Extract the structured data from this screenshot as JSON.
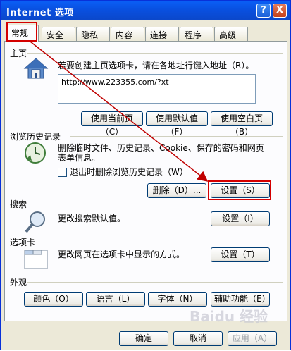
{
  "window": {
    "title": "Internet 选项"
  },
  "titlebar_buttons": {
    "help": "?",
    "close": "X"
  },
  "tabs": [
    "常规",
    "安全",
    "隐私",
    "内容",
    "连接",
    "程序",
    "高级"
  ],
  "home": {
    "heading": "主页",
    "desc": "若要创建主页选项卡，请在各地址行键入地址（R）。",
    "url": "http://www.223355.com/?xt",
    "buttons": [
      "使用当前页（C）",
      "使用默认值（F）",
      "使用空白页（B）"
    ]
  },
  "history": {
    "heading": "浏览历史记录",
    "desc_line1": "删除临时文件、历史记录、Cookie、保存的密码和网页",
    "desc_line2": "表单信息。",
    "checkbox_label": "退出时删除浏览历史记录（W）",
    "delete_button": "删除（D）...",
    "settings_button": "设置（S）"
  },
  "search": {
    "heading": "搜索",
    "desc": "更改搜索默认值。",
    "settings_button": "设置（I）"
  },
  "tabs_section": {
    "heading": "选项卡",
    "desc": "更改网页在选项卡中显示的方式。",
    "settings_button": "设置（T）"
  },
  "appearance": {
    "heading": "外观",
    "buttons": [
      "颜色（O）",
      "语言（L）",
      "字体（N）",
      "辅助功能（E）"
    ]
  },
  "footer": {
    "ok": "确定",
    "cancel": "取消",
    "apply": "应用（A）"
  },
  "watermark": "Baidu 经验"
}
